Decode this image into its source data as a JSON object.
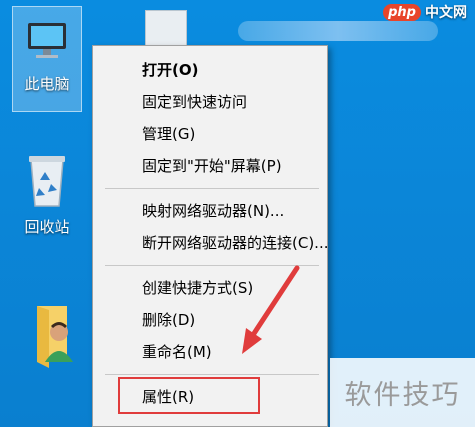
{
  "desktop": {
    "icons": [
      {
        "label": "此电脑"
      },
      {
        "label": "回收站"
      }
    ],
    "watermark_top": {
      "badge": "php",
      "text": "中文网"
    },
    "watermark_bottom": "软件技巧"
  },
  "context_menu": {
    "groups": [
      [
        "打开(O)",
        "固定到快速访问",
        "管理(G)",
        "固定到\"开始\"屏幕(P)"
      ],
      [
        "映射网络驱动器(N)...",
        "断开网络驱动器的连接(C)..."
      ],
      [
        "创建快捷方式(S)",
        "删除(D)",
        "重命名(M)"
      ],
      [
        "属性(R)"
      ]
    ],
    "highlighted_item": "属性(R)"
  },
  "colors": {
    "desktop_bg": "#0a86d8",
    "menu_bg": "#f2f2f2",
    "annotation_red": "#e03c3c"
  }
}
